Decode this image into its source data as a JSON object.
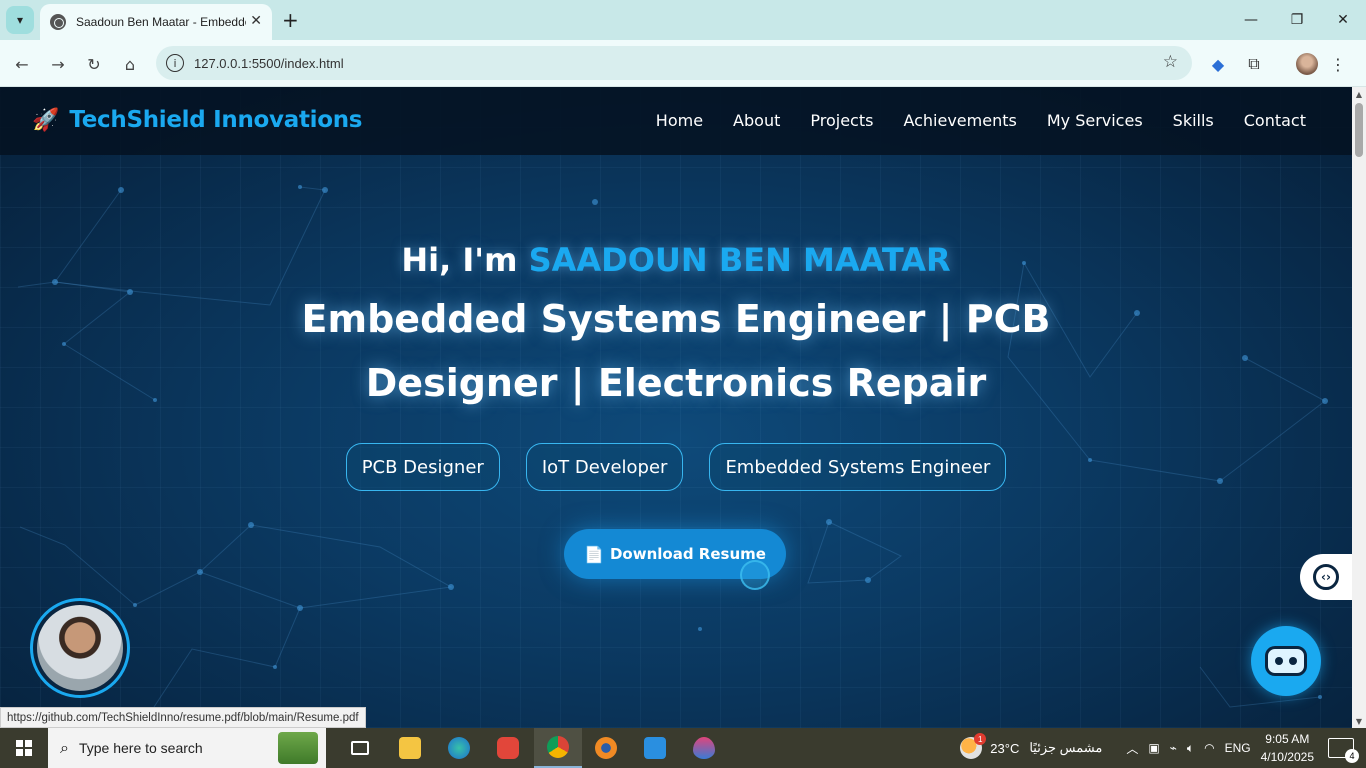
{
  "browser": {
    "tab_title": "Saadoun Ben Maatar - Embedded",
    "url": "127.0.0.1:5500/index.html",
    "status_url": "https://github.com/TechShieldInno/resume.pdf/blob/main/Resume.pdf"
  },
  "site": {
    "brand": "TechShield Innovations",
    "nav": [
      "Home",
      "About",
      "Projects",
      "Achievements",
      "My Services",
      "Skills",
      "Contact"
    ],
    "greeting_prefix": "Hi, I'm ",
    "greeting_name": "SAADOUN BEN MAATAR",
    "headline": "Embedded Systems Engineer | PCB Designer | Electronics Repair",
    "roles": [
      "PCB Designer",
      "IoT Developer",
      "Embedded Systems Engineer"
    ],
    "resume_button": "Download Resume",
    "resume_icon": "document-icon",
    "accent_color": "#1aa9f0"
  },
  "taskbar": {
    "search_placeholder": "Type here to search",
    "weather_temp": "23°C",
    "weather_desc": "مشمس جزئيًا",
    "weather_badge": "1",
    "language": "ENG",
    "time": "9:05 AM",
    "date": "4/10/2025",
    "notification_count": "4"
  }
}
